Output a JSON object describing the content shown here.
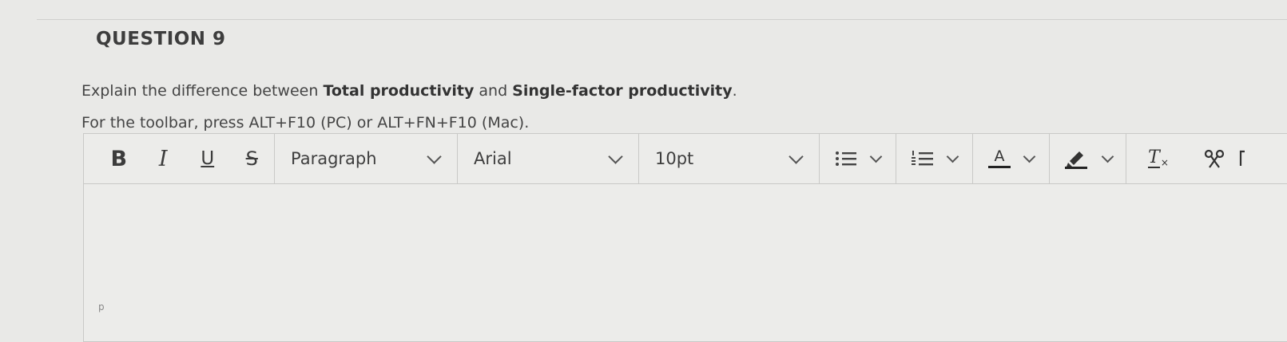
{
  "question": {
    "heading": "QUESTION 9",
    "text_prefix": "Explain the difference between ",
    "term_1": "Total productivity",
    "text_middle": " and ",
    "term_2": "Single-factor productivity",
    "text_suffix": ".",
    "toolbar_hint": "For the toolbar, press ALT+F10 (PC) or ALT+FN+F10 (Mac)."
  },
  "toolbar": {
    "bold_label": "B",
    "italic_label": "I",
    "underline_label": "U",
    "strike_label": "S",
    "block_format": "Paragraph",
    "font_family": "Arial",
    "font_size": "10pt",
    "text_color_label": "A",
    "clear_format_label": "T",
    "icons": [
      "bullet-list-icon",
      "numbered-list-icon",
      "text-color-icon",
      "highlight-icon",
      "clear-formatting-icon",
      "cut-icon"
    ]
  },
  "editor": {
    "path_hint": "p"
  }
}
